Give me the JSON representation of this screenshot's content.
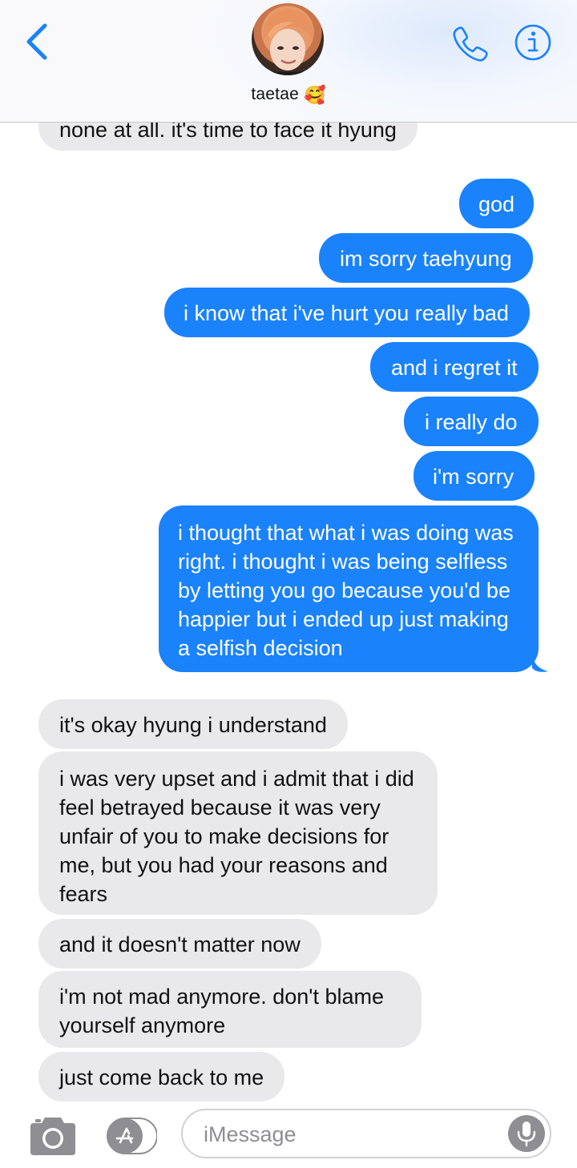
{
  "header": {
    "contact_name": "taetae",
    "contact_emoji": "🥰",
    "back_icon": "chevron-left-icon",
    "call_icon": "phone-icon",
    "info_icon": "info-icon",
    "accent_color": "#1a82fb"
  },
  "messages": [
    {
      "from": "them",
      "text": "none at all. it's time to face it hyung"
    },
    {
      "from": "me",
      "text": "god"
    },
    {
      "from": "me",
      "text": "im sorry taehyung"
    },
    {
      "from": "me",
      "text": "i know that i've hurt you really bad"
    },
    {
      "from": "me",
      "text": "and i regret it"
    },
    {
      "from": "me",
      "text": "i really do"
    },
    {
      "from": "me",
      "text": "i'm sorry"
    },
    {
      "from": "me",
      "text": "i thought that what i was doing was right. i thought i was being selfless by letting you go because you'd be happier but i ended up just making a selfish decision"
    },
    {
      "from": "them",
      "text": "it's okay hyung i understand"
    },
    {
      "from": "them",
      "text": "i was very upset and i admit that i did feel betrayed because it was very unfair of you to make decisions for me, but you had your reasons and fears"
    },
    {
      "from": "them",
      "text": "and it doesn't matter now"
    },
    {
      "from": "them",
      "text": "i'm not mad anymore. don't blame yourself anymore"
    },
    {
      "from": "them",
      "text": "just come back to me"
    }
  ],
  "colors": {
    "sent_bubble": "#1a82fb",
    "received_bubble": "#e9e9eb"
  },
  "composer": {
    "placeholder": "iMessage",
    "camera_icon": "camera-icon",
    "apps_icon": "app-store-icon",
    "mic_icon": "microphone-icon"
  }
}
